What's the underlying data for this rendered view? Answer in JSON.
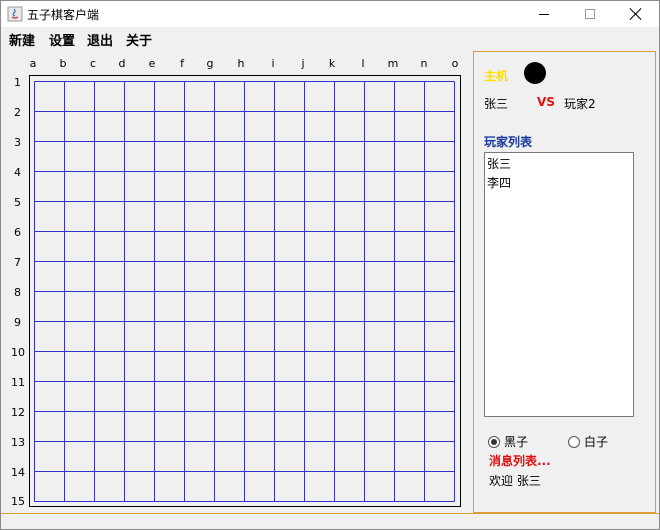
{
  "window": {
    "title": "五子棋客户端"
  },
  "menu": {
    "items": [
      "新建",
      "设置",
      "退出",
      "关于"
    ]
  },
  "board": {
    "columns": [
      "a",
      "b",
      "c",
      "d",
      "e",
      "f",
      "g",
      "h",
      "i",
      "j",
      "k",
      "l",
      "m",
      "n",
      "o"
    ],
    "rows": [
      "1",
      "2",
      "3",
      "4",
      "5",
      "6",
      "7",
      "8",
      "9",
      "10",
      "11",
      "12",
      "13",
      "14",
      "15"
    ],
    "line_color": "#3333cc"
  },
  "side": {
    "host_label": "主机",
    "player1": "张三",
    "vs": "VS",
    "player2": "玩家2",
    "player_list_title": "玩家列表",
    "player_list": [
      "张三",
      "李四"
    ],
    "radio_black_label": "黑子",
    "radio_white_label": "白子",
    "radio_selected": "黑子",
    "message_title": "消息列表...",
    "welcome_text": "欢迎 张三"
  },
  "colors": {
    "host_label": "#ffe000",
    "vs": "#e01010",
    "list_title": "#1a3a9a",
    "message_title": "#e01010"
  }
}
